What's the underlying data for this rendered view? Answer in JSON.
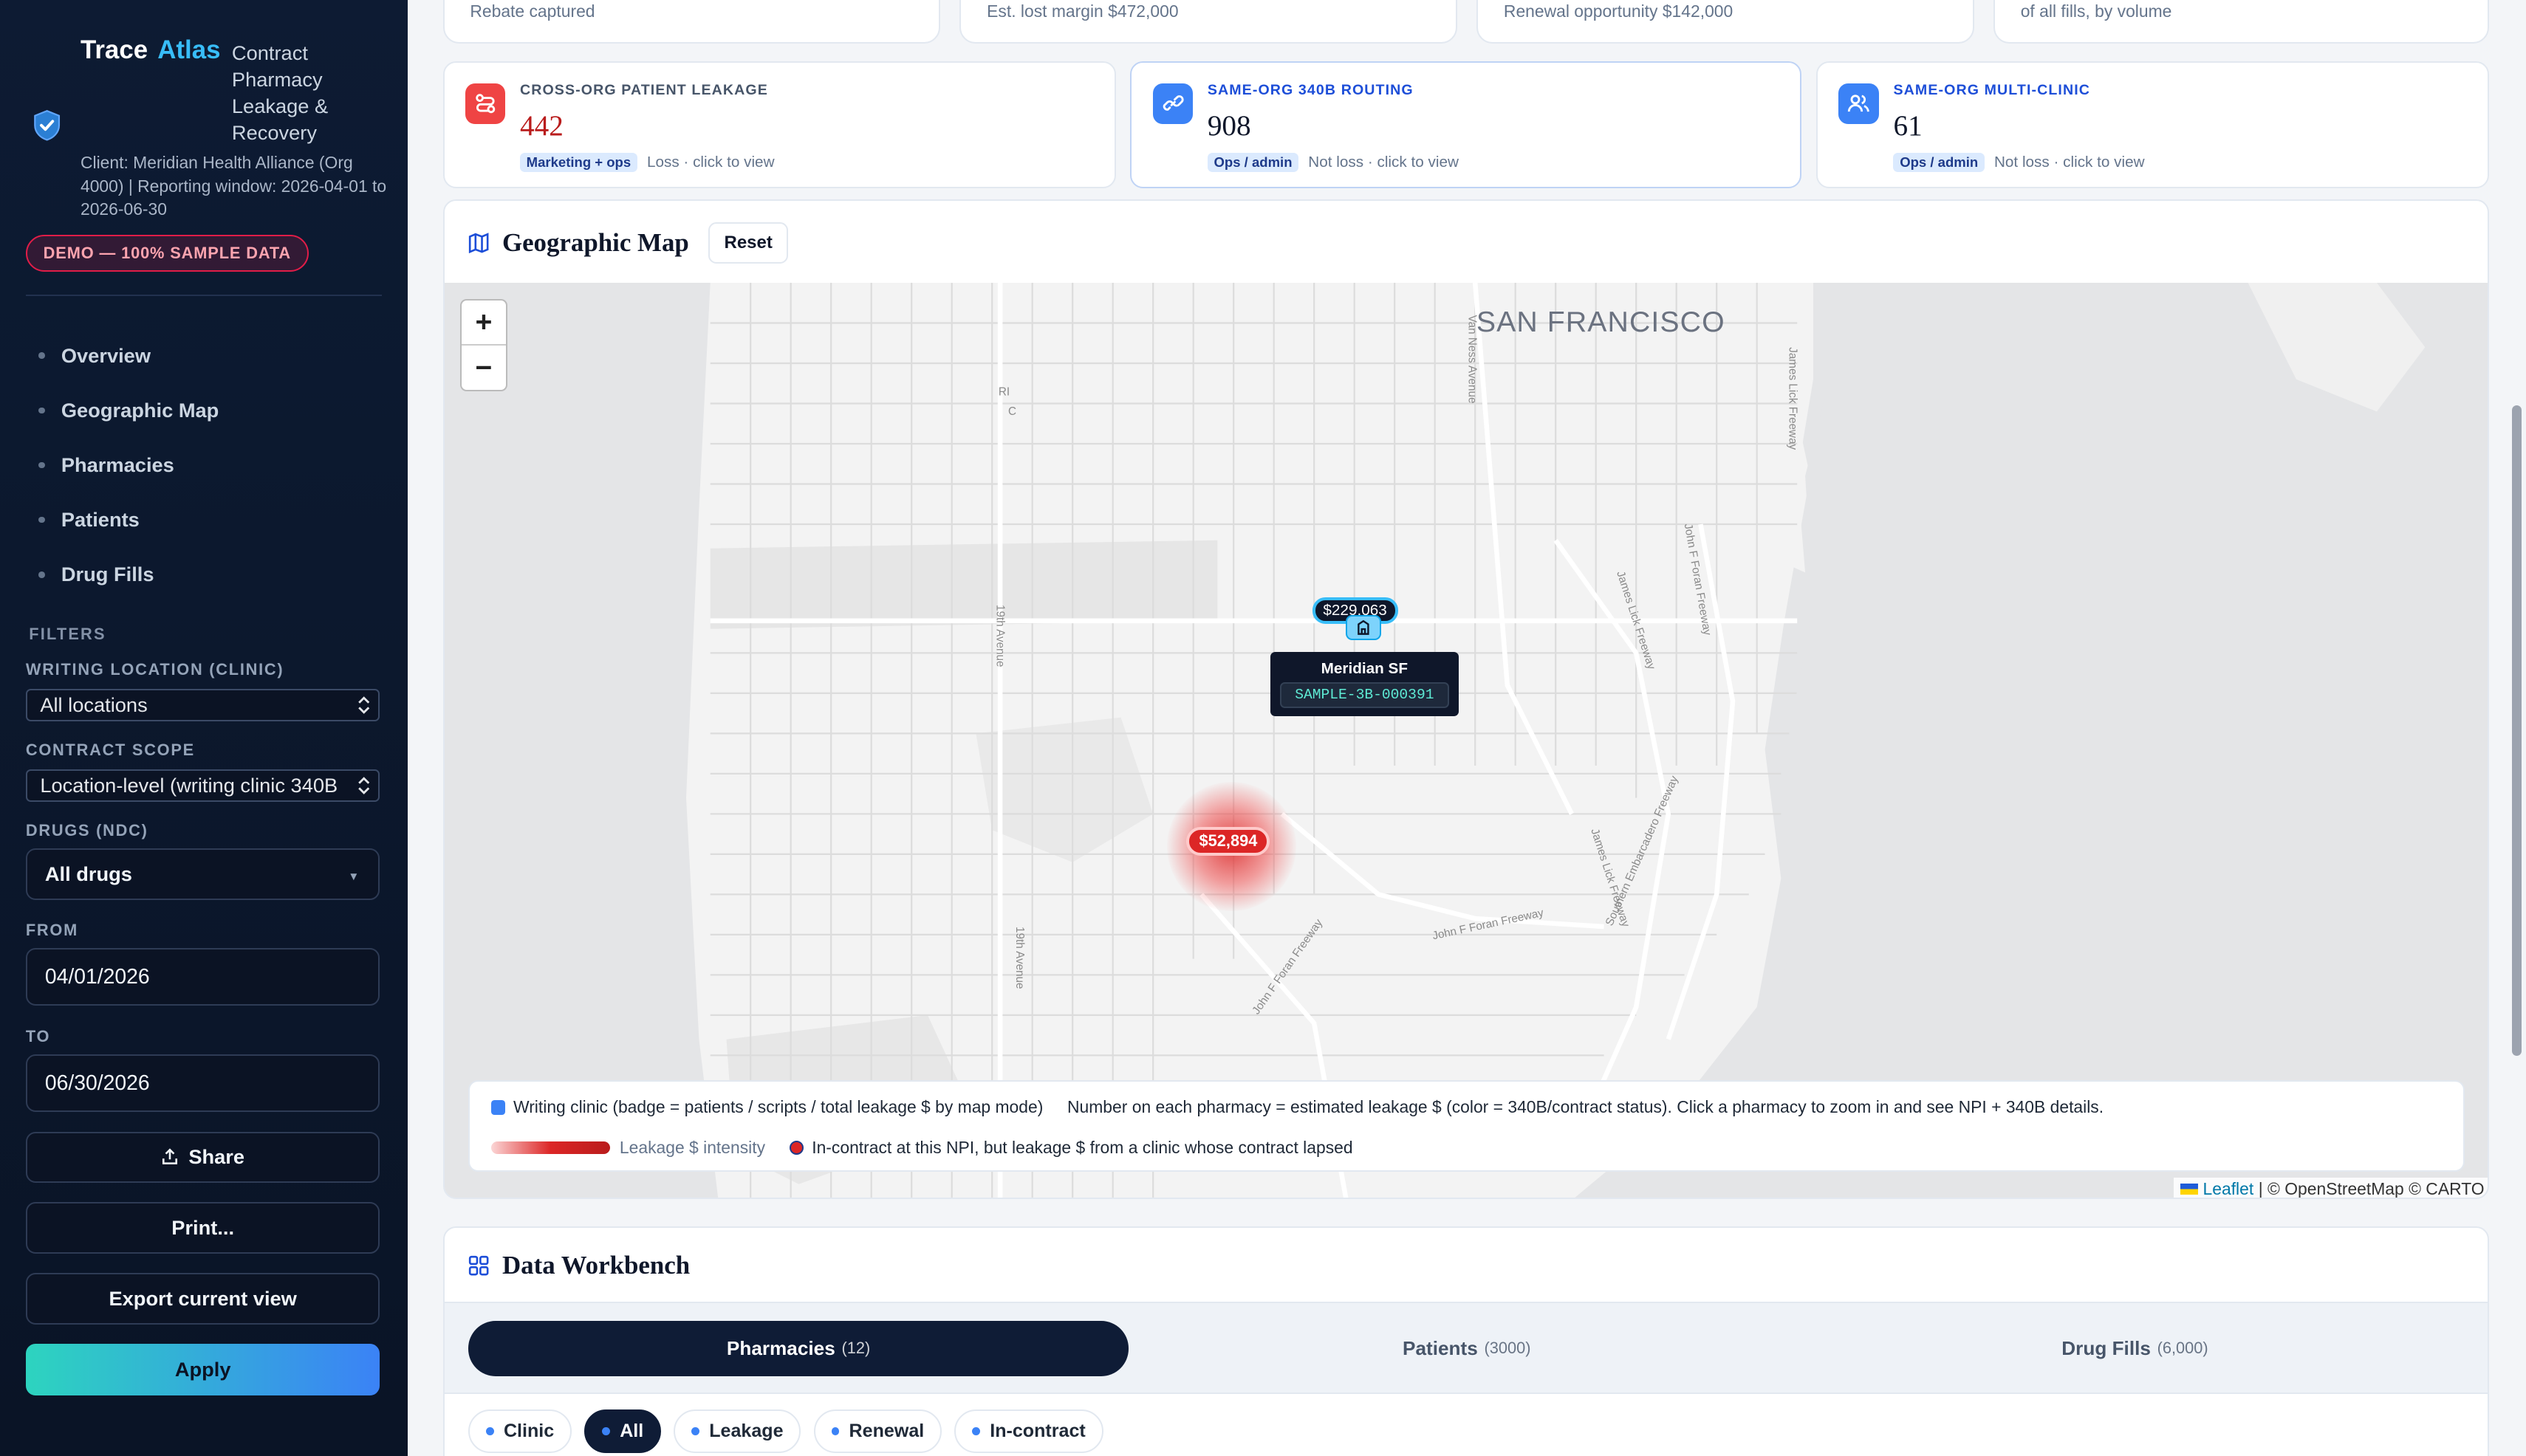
{
  "brand": {
    "name": "Trace",
    "name_accent": "Atlas",
    "tagline": "Contract Pharmacy Leakage & Recovery",
    "client": "Client: Meridian Health Alliance (Org 4000)  |  Reporting window: 2026-04-01 to 2026-06-30",
    "demo_badge": "DEMO — 100% SAMPLE DATA"
  },
  "nav": [
    {
      "label": "Overview"
    },
    {
      "label": "Geographic Map"
    },
    {
      "label": "Pharmacies"
    },
    {
      "label": "Patients"
    },
    {
      "label": "Drug Fills"
    }
  ],
  "filters": {
    "heading": "FILTERS",
    "writing_location_label": "WRITING LOCATION (CLINIC)",
    "writing_location_value": "All locations",
    "contract_scope_label": "CONTRACT SCOPE",
    "contract_scope_value": "Location-level (writing clinic 340B",
    "drugs_label": "DRUGS (NDC)",
    "drugs_value": "All drugs",
    "from_label": "FROM",
    "from_value": "04/01/2026",
    "to_label": "TO",
    "to_value": "06/30/2026",
    "share": "Share",
    "print": "Print...",
    "export": "Export current view",
    "apply": "Apply"
  },
  "top_cards": [
    {
      "text": "Rebate captured"
    },
    {
      "text": "Est. lost margin $472,000"
    },
    {
      "text": "Renewal opportunity $142,000"
    },
    {
      "text": "of all fills, by volume"
    }
  ],
  "cards": [
    {
      "label": "CROSS-ORG PATIENT LEAKAGE",
      "value": "442",
      "chip": "Marketing + ops",
      "meta": "Loss · click to view",
      "label_color": "#475569",
      "value_color": "#b91c1c",
      "icon_bg": "#ef4444"
    },
    {
      "label": "SAME-ORG 340B ROUTING",
      "value": "908",
      "chip": "Ops / admin",
      "meta": "Not loss · click to view",
      "label_color": "#1d4ed8",
      "value_color": "#0f172a",
      "icon_bg": "#3b82f6"
    },
    {
      "label": "SAME-ORG MULTI-CLINIC",
      "value": "61",
      "chip": "Ops / admin",
      "meta": "Not loss · click to view",
      "label_color": "#1d4ed8",
      "value_color": "#0f172a",
      "icon_bg": "#3b82f6"
    }
  ],
  "map_panel": {
    "title": "Geographic Map",
    "reset": "Reset",
    "city": "SAN FRANCISCO",
    "clinic_badge": "$229,063",
    "tooltip_name": "Meridian SF",
    "tooltip_code": "SAMPLE-3B-000391",
    "leak_badge": "$52,894",
    "legend_writing_clinic": "Writing clinic (badge = patients / scripts / total leakage $ by map mode)",
    "legend_number": "Number on each pharmacy = estimated leakage $ (color = 340B/contract status). Click a pharmacy to zoom in and see NPI + 340B details.",
    "legend_intensity": "Leakage $ intensity",
    "legend_incontract": "In-contract at this NPI, but leakage $ from a clinic whose contract lapsed",
    "attribution_leaflet": "Leaflet",
    "attribution_rest": "| © OpenStreetMap © CARTO",
    "zoom_in": "+",
    "zoom_out": "−",
    "street_labels": [
      "Van Ness Avenue",
      "19th Avenue",
      "19th Avenue",
      "James Lick Freeway",
      "John F Foran Freeway",
      "John F Foran Freeway",
      "Southern Embarcadero Freeway",
      "James Lick Freeway",
      "John F Foran Freeway",
      "James Lick Freeway",
      "RI",
      "C"
    ]
  },
  "workbench": {
    "title": "Data Workbench",
    "tabs": [
      {
        "label": "Pharmacies",
        "count": "(12)"
      },
      {
        "label": "Patients",
        "count": "(3000)"
      },
      {
        "label": "Drug Fills",
        "count": "(6,000)"
      }
    ],
    "pills": [
      {
        "label": "Clinic"
      },
      {
        "label": "All"
      },
      {
        "label": "Leakage"
      },
      {
        "label": "Renewal"
      },
      {
        "label": "In-contract"
      }
    ]
  }
}
